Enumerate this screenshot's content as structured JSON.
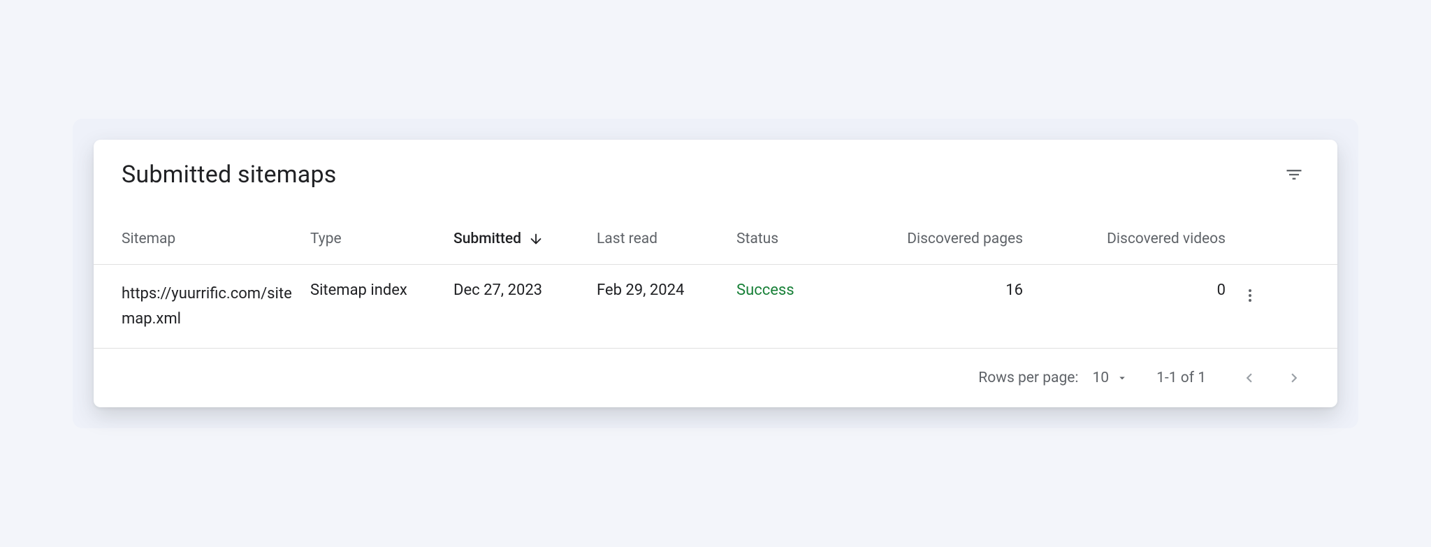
{
  "card": {
    "title": "Submitted sitemaps"
  },
  "columns": {
    "sitemap": "Sitemap",
    "type": "Type",
    "submitted": "Submitted",
    "last_read": "Last read",
    "status": "Status",
    "discovered_pages": "Discovered pages",
    "discovered_videos": "Discovered videos"
  },
  "sort": {
    "column": "submitted",
    "direction": "desc"
  },
  "rows": [
    {
      "sitemap": "https://yuurrific.com/sitemap.xml",
      "type": "Sitemap index",
      "submitted": "Dec 27, 2023",
      "last_read": "Feb 29, 2024",
      "status": "Success",
      "status_kind": "success",
      "discovered_pages": "16",
      "discovered_videos": "0"
    }
  ],
  "pagination": {
    "rows_per_page_label": "Rows per page:",
    "rows_per_page_value": "10",
    "range": "1-1 of 1"
  }
}
